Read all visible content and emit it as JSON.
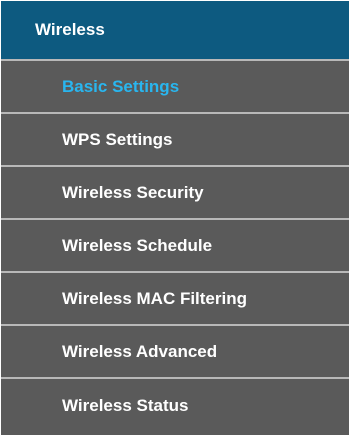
{
  "menu": {
    "header": "Wireless",
    "items": [
      {
        "label": "Basic Settings",
        "active": true
      },
      {
        "label": "WPS Settings",
        "active": false
      },
      {
        "label": "Wireless Security",
        "active": false
      },
      {
        "label": "Wireless Schedule",
        "active": false
      },
      {
        "label": "Wireless MAC Filtering",
        "active": false
      },
      {
        "label": "Wireless Advanced",
        "active": false
      },
      {
        "label": "Wireless Status",
        "active": false
      }
    ]
  },
  "colors": {
    "header_bg": "#0d5a80",
    "item_bg": "#5a5a5a",
    "active_text": "#29b6ef",
    "divider": "#b8b8b8"
  }
}
